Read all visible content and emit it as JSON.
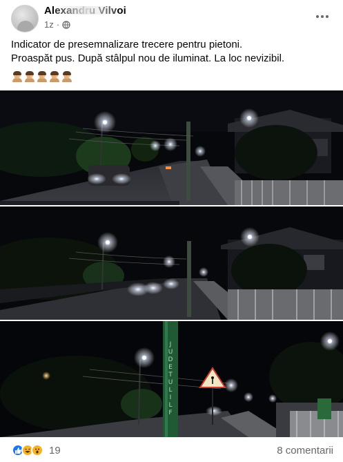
{
  "post": {
    "author": "Alexandru Vilvoi",
    "time": "1z",
    "text_line1": "Indicator de presemnalizare trecere pentru pietoni.",
    "text_line2": "Proaspăt pus. După stâlpul nou de iluminat. La loc nevizibil.",
    "emoji_count": 5
  },
  "icons": {
    "privacy": "globe-icon",
    "more": "more-options-icon",
    "reactions": [
      "like-icon",
      "haha-icon",
      "wow-icon"
    ]
  },
  "photos": {
    "pole_lettering": "JUDETUL ILF"
  },
  "footer": {
    "reaction_count": "19",
    "comments": "8 comentarii"
  },
  "colors": {
    "text": "#050505",
    "secondary_text": "#65676b",
    "like_blue": "#1877f2",
    "haha_yellow": "#f7b125"
  }
}
